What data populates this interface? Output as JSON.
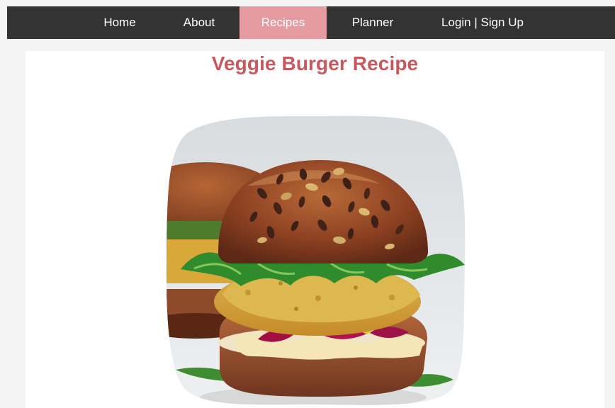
{
  "nav": {
    "items": [
      {
        "label": "Home",
        "active": false
      },
      {
        "label": "About",
        "active": false
      },
      {
        "label": "Recipes",
        "active": true
      },
      {
        "label": "Planner",
        "active": false
      },
      {
        "label": "Login | Sign Up",
        "active": false
      }
    ],
    "active_color": "#e59b9f",
    "bar_color": "#333333"
  },
  "main": {
    "title": "Veggie Burger Recipe",
    "title_color": "#c6585e"
  }
}
